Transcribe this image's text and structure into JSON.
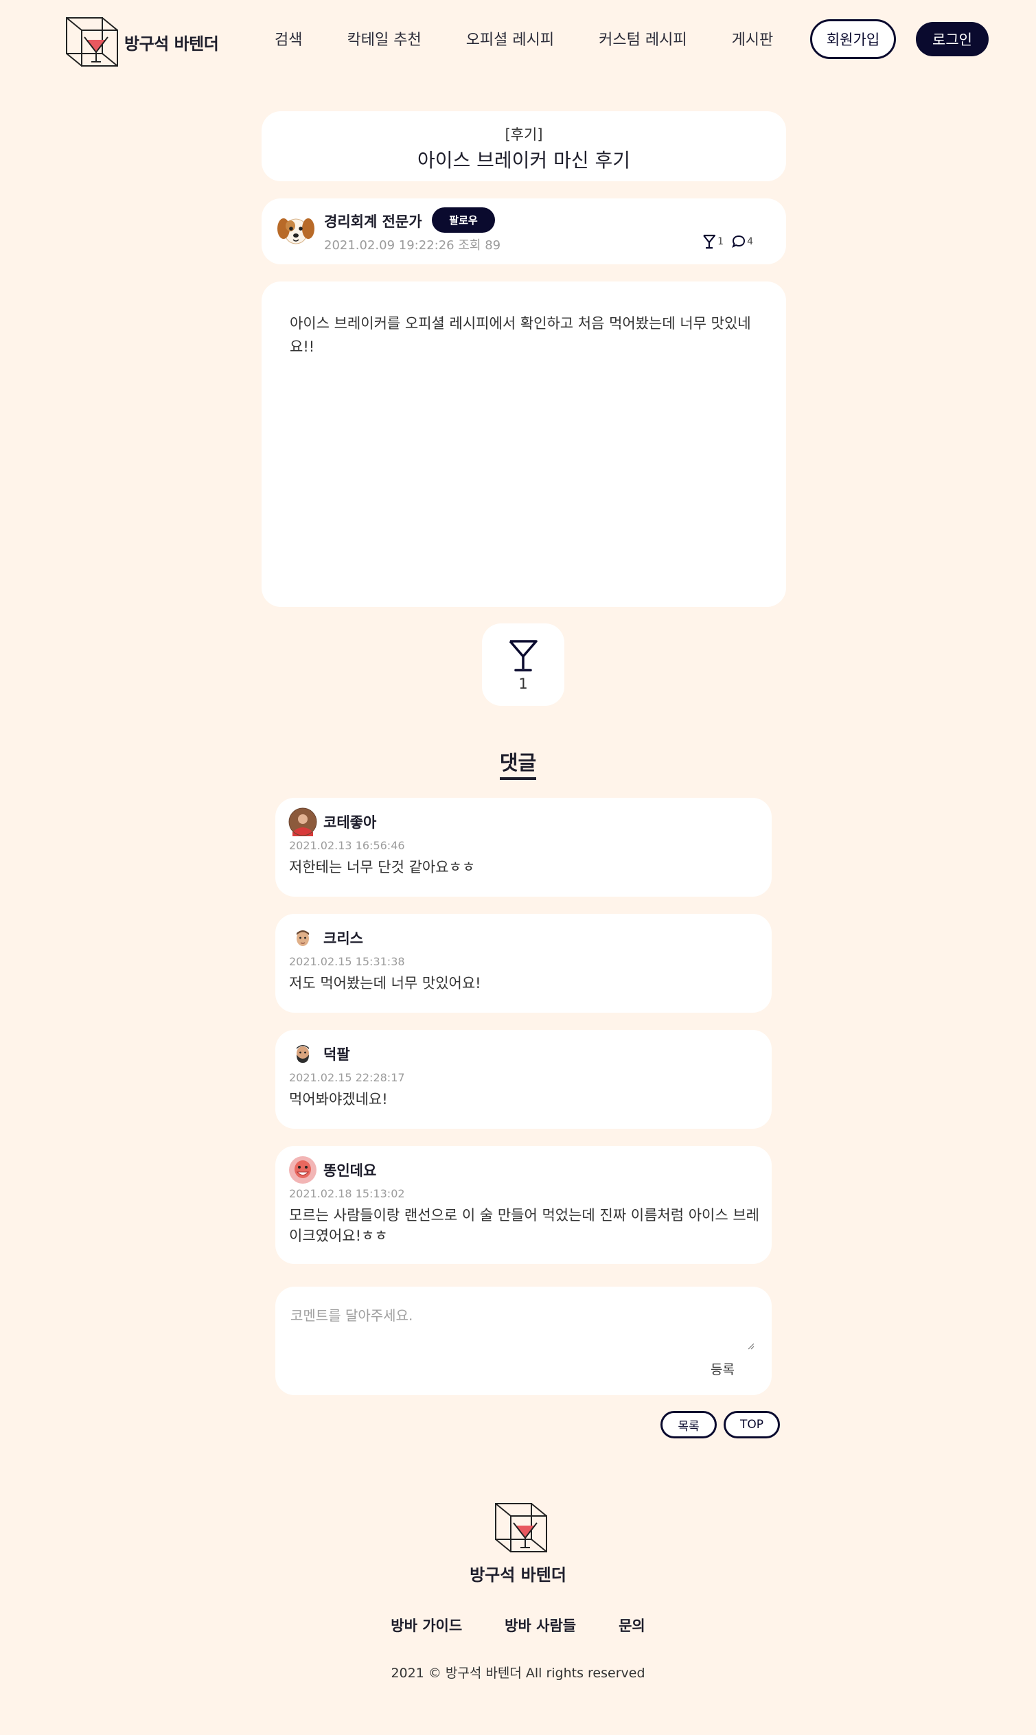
{
  "header": {
    "brand": "방구석 바텐더",
    "nav": [
      "검색",
      "칵테일 추천",
      "오피셜 레시피",
      "커스텀 레시피",
      "게시판"
    ],
    "signup_label": "회원가입",
    "login_label": "로그인"
  },
  "post": {
    "category": "[후기]",
    "title": "아이스 브레이커 마신 후기",
    "author": "경리회계 전문가",
    "follow_label": "팔로우",
    "datetime": "2021.02.09 19:22:26",
    "views_label": "조회 89",
    "like_count": "1",
    "comment_count": "4",
    "body": "아이스 브레이커를 오피셜 레시피에서 확인하고 처음 먹어봤는데 너무 맛있네요!!",
    "big_like_count": "1"
  },
  "comments_section": {
    "title": "댓글",
    "items": [
      {
        "author": "코테좋아",
        "date": "2021.02.13 16:56:46",
        "text": "저한테는 너무 단것 같아요ㅎㅎ",
        "avatar": "red-shirt-avatar"
      },
      {
        "author": "크리스",
        "date": "2021.02.15 15:31:38",
        "text": "저도 먹어봤는데 너무 맛있어요!",
        "avatar": "man-avatar"
      },
      {
        "author": "덕팔",
        "date": "2021.02.15 22:28:17",
        "text": "먹어봐야겠네요!",
        "avatar": "bearded-man-avatar"
      },
      {
        "author": "똥인데요",
        "date": "2021.02.18 15:13:02",
        "text": "모르는 사람들이랑 랜선으로 이 술 만들어 먹었는데 진짜 이름처럼 아이스 브레이크였어요!ㅎㅎ",
        "avatar": "smiling-avatar"
      }
    ]
  },
  "comment_form": {
    "placeholder": "코멘트를 달아주세요.",
    "submit_label": "등록"
  },
  "buttons": {
    "list_label": "목록",
    "top_label": "TOP"
  },
  "footer": {
    "brand": "방구석 바텐더",
    "links": [
      "방바 가이드",
      "방바 사람들",
      "문의"
    ],
    "copyright": "2021 © 방구석 바텐더 All rights reserved"
  },
  "colors": {
    "background": "#fff4ea",
    "navy": "#0a0a2e",
    "card": "#ffffff",
    "cocktail_red": "#e8585f"
  }
}
